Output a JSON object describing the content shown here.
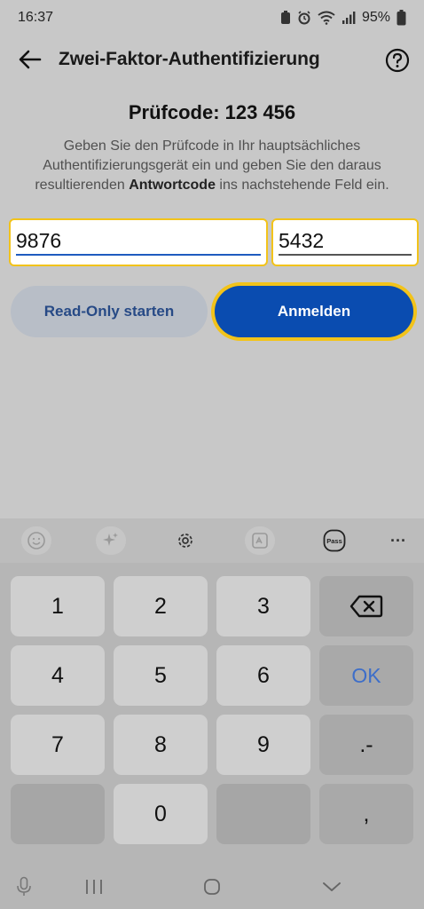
{
  "status": {
    "time": "16:37",
    "battery": "95%"
  },
  "header": {
    "title": "Zwei-Faktor-Authentifizierung"
  },
  "main": {
    "code_title": "Prüfcode: 123 456",
    "instructions_part1": "Geben Sie den Prüfcode in Ihr hauptsächliches Authentifizierungsgerät ein und geben Sie den daraus resultierenden ",
    "instructions_bold": "Antwortcode",
    "instructions_part2": " ins nachstehende Feld ein.",
    "field1_value": "9876",
    "field2_value": "5432",
    "readonly_label": "Read-Only starten",
    "login_label": "Anmelden"
  },
  "keyboard": {
    "toolbar_icons": [
      "emoji-icon",
      "sparkle-icon",
      "settings-icon",
      "image-translate-icon",
      "pass-icon",
      "more-icon"
    ],
    "pass_label": "Pass",
    "more_label": "···",
    "keys": {
      "k1": "1",
      "k2": "2",
      "k3": "3",
      "k4": "4",
      "k5": "5",
      "k6": "6",
      "k7": "7",
      "k8": "8",
      "k9": "9",
      "k0": "0",
      "ok": "OK",
      "dot_dash": ".-",
      "comma": ","
    }
  },
  "colors": {
    "focus_border": "#f2c31a",
    "primary": "#0a4cb0",
    "secondary_button": "#b8bec7",
    "ok_key": "#3d6ec9"
  }
}
